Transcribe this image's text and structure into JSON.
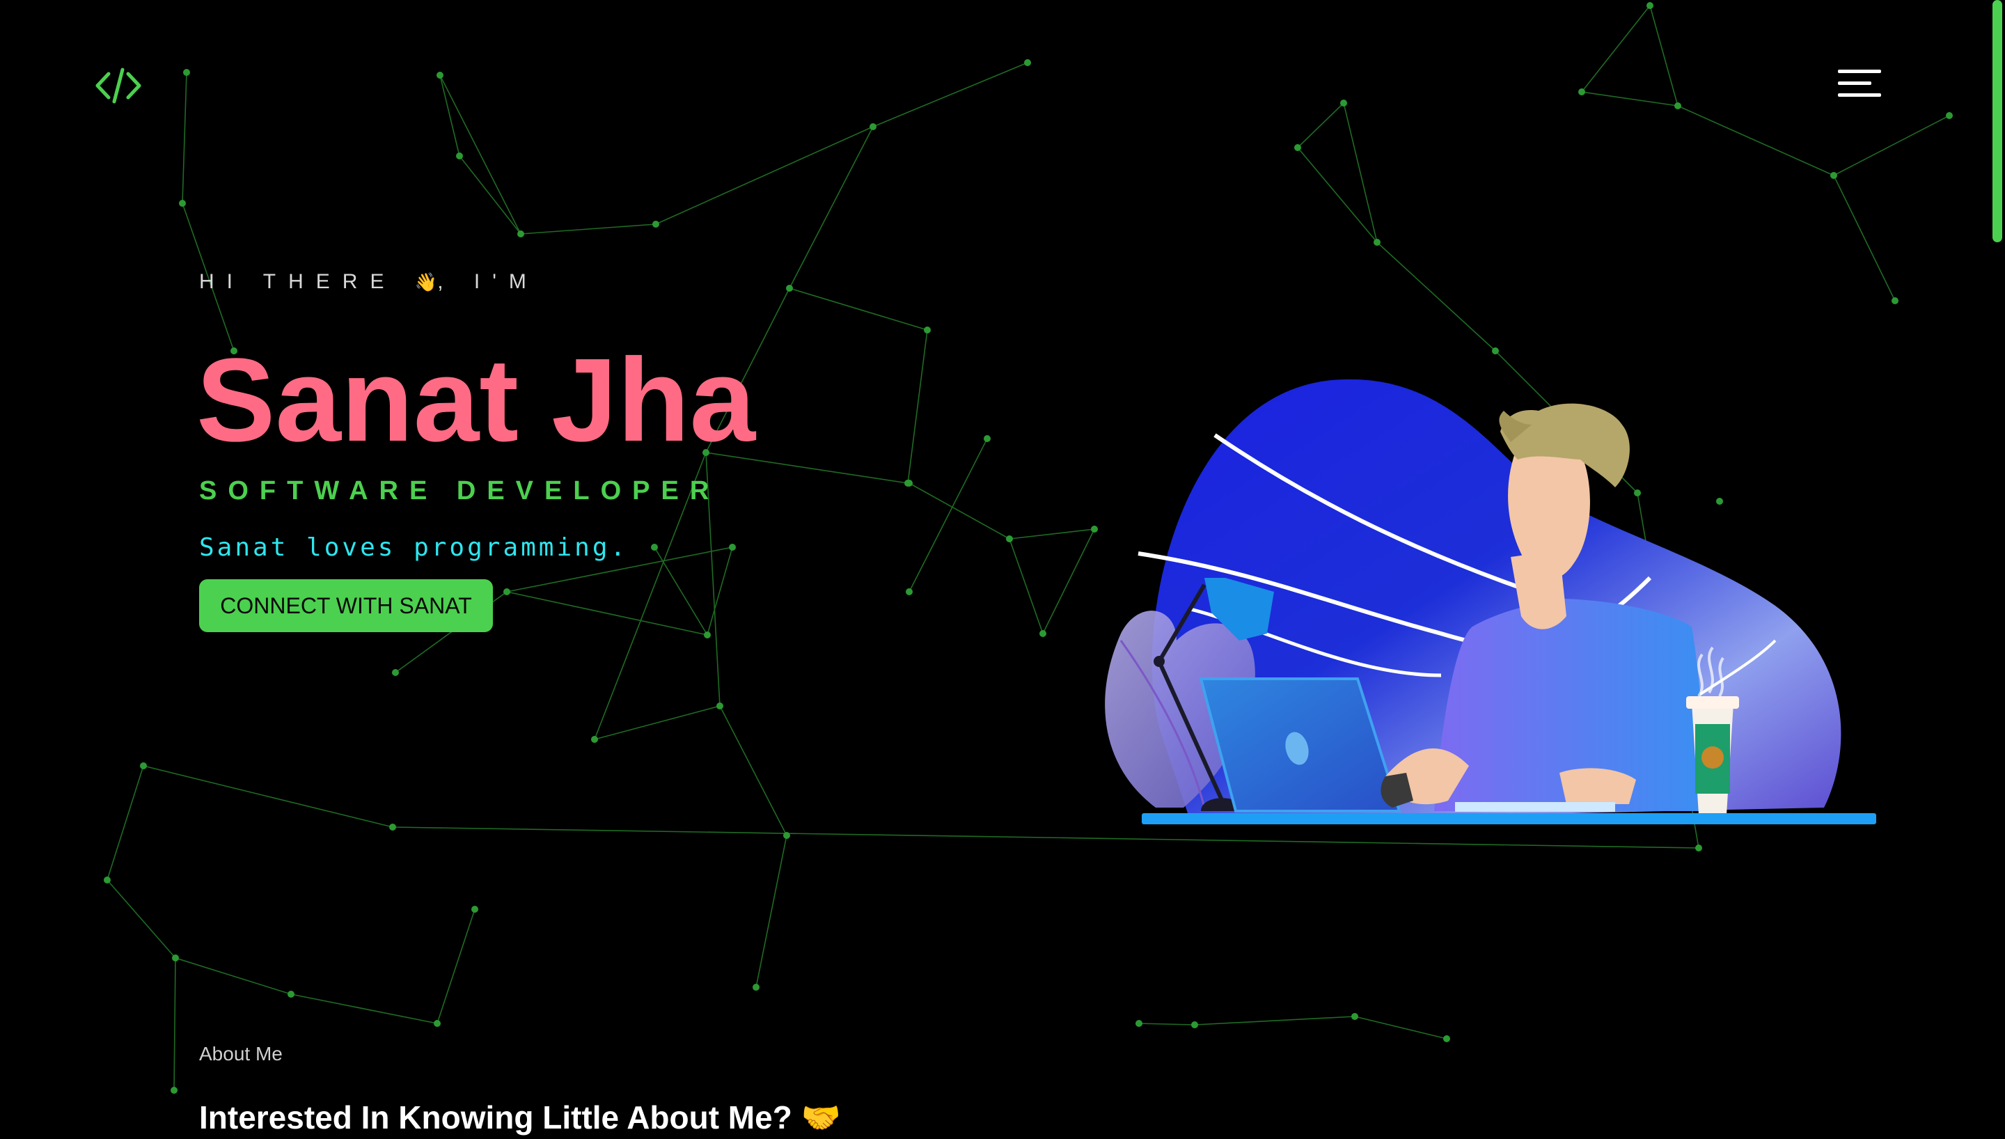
{
  "header": {
    "logo_icon": "code-brackets-icon",
    "menu_icon": "hamburger-menu-icon"
  },
  "hero": {
    "greeting": "HI THERE",
    "greeting_emoji": "👋",
    "greeting_suffix": ", I'M",
    "name": "Sanat Jha",
    "role": "SOFTWARE DEVELOPER",
    "tagline": "Sanat loves programming.",
    "cta_label": "CONNECT WITH SANAT",
    "illustration": "developer-at-desk-illustration"
  },
  "about": {
    "label": "About Me",
    "heading": "Interested In Knowing Little About Me?",
    "heading_emoji": "🤝"
  },
  "colors": {
    "background": "#000000",
    "accent_green": "#4cd04f",
    "name_pink": "#ff6b84",
    "tagline_cyan": "#2ee6ef",
    "network_line": "#1f6b24"
  }
}
